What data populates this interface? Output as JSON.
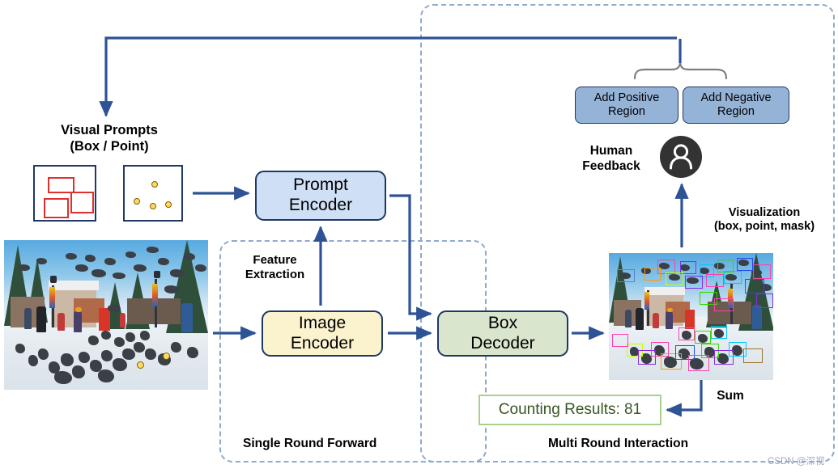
{
  "diagram": {
    "containers": [
      {
        "name": "single-round-forward",
        "label": "Single Round Forward"
      },
      {
        "name": "multi-round-interaction",
        "label": "Multi Round Interaction"
      }
    ],
    "nodes": {
      "prompt_encoder": {
        "line1": "Prompt",
        "line2": "Encoder",
        "color": "#cfdff5"
      },
      "image_encoder": {
        "line1": "Image",
        "line2": "Encoder",
        "color": "#fbf2ce"
      },
      "box_decoder": {
        "line1": "Box",
        "line2": "Decoder",
        "color": "#d9e5cc"
      }
    },
    "buttons": {
      "add_positive": {
        "line1": "Add Positive",
        "line2": "Region"
      },
      "add_negative": {
        "line1": "Add Negative",
        "line2": "Region"
      }
    },
    "labels": {
      "visual_prompts_line1": "Visual Prompts",
      "visual_prompts_line2": "(Box / Point)",
      "feature_extraction_line1": "Feature",
      "feature_extraction_line2": "Extraction",
      "human_feedback_line1": "Human",
      "human_feedback_line2": "Feedback",
      "visualization_line1": "Visualization",
      "visualization_line2": "(box, point, mask)",
      "sum": "Sum"
    },
    "counting_results": {
      "text": "Counting Results: 81",
      "count": 81,
      "text_color": "#375623",
      "border_color": "#a9d08e"
    },
    "icons": {
      "human": "user-avatar-icon"
    },
    "photos": {
      "source": "winter-town-square-with-pigeons",
      "annotated": "winter-town-square-with-pigeons-detection-boxes"
    },
    "colors": {
      "arrow": "#2e5395",
      "dashed_border": "#8faacb",
      "node_border": "#1f3864",
      "button_fill": "#95b3d7",
      "red_prompt_box": "#e0302c",
      "yellow_prompt_point": "#ffd966"
    },
    "watermark": "CSDN @深视"
  }
}
